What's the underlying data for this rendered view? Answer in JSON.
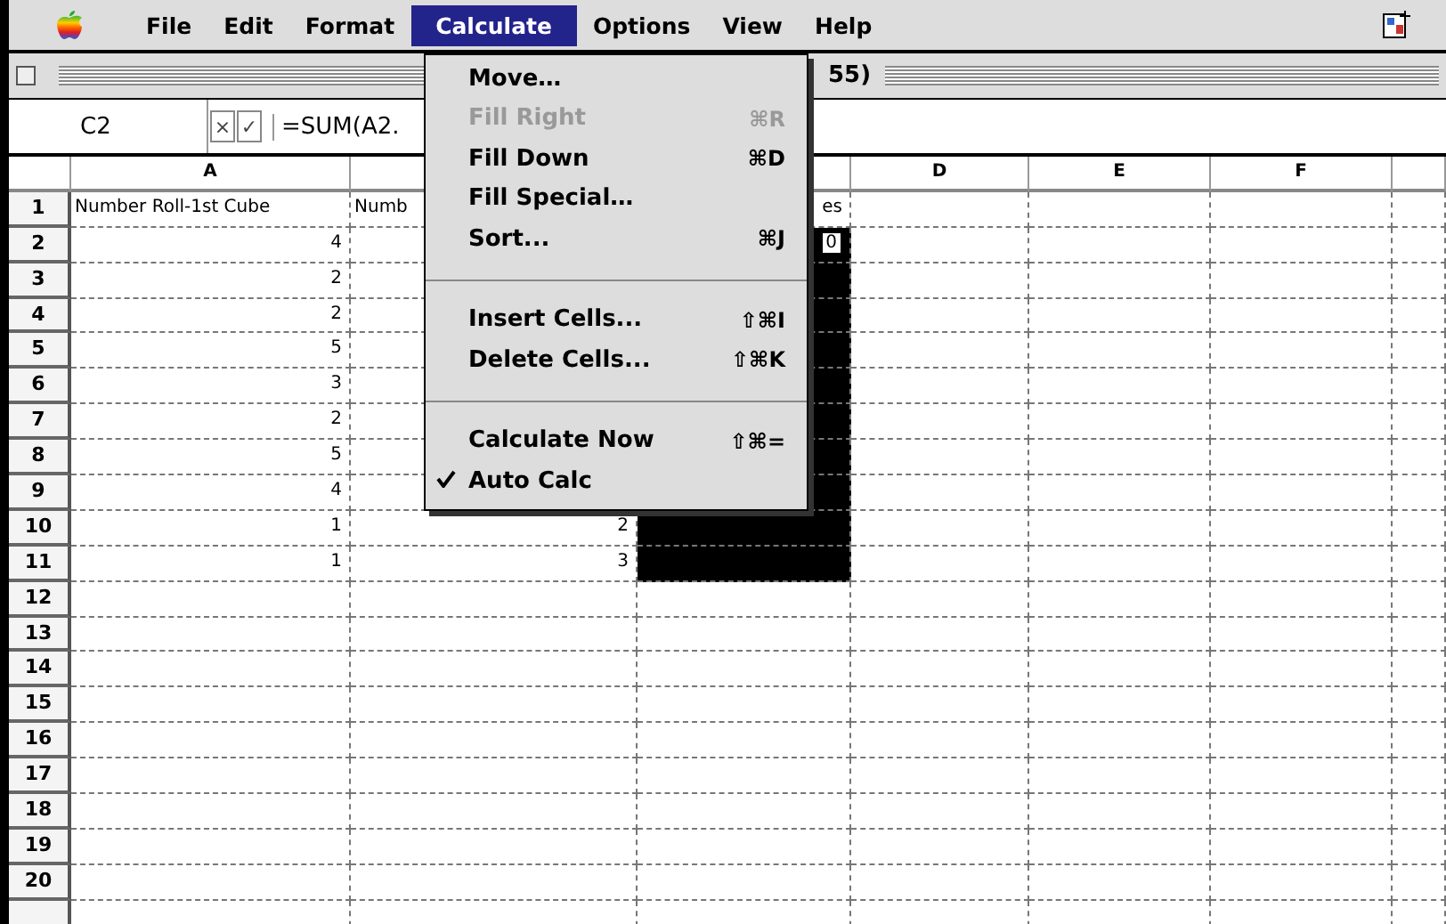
{
  "menubar": {
    "items": [
      {
        "label": "File",
        "selected": false
      },
      {
        "label": "Edit",
        "selected": false
      },
      {
        "label": "Format",
        "selected": false
      },
      {
        "label": "Calculate",
        "selected": true
      },
      {
        "label": "Options",
        "selected": false
      },
      {
        "label": "View",
        "selected": false
      },
      {
        "label": "Help",
        "selected": false
      }
    ]
  },
  "window": {
    "title": "55)"
  },
  "formula_bar": {
    "cell_ref": "C2",
    "cancel": "×",
    "accept": "✓",
    "formula": "=SUM(A2."
  },
  "spreadsheet": {
    "columns": [
      {
        "label": "A"
      },
      {},
      {},
      {
        "label": "D"
      },
      {
        "label": "E"
      },
      {
        "label": "F"
      }
    ],
    "rows": [
      {
        "number": "1",
        "cells": [
          {
            "text": "Number Roll-1st Cube",
            "selected": false
          },
          {
            "text": "Numb",
            "selected": false
          },
          {
            "text": "es",
            "selected": false
          },
          {
            "selected": false
          },
          {
            "selected": false
          },
          {
            "selected": false
          }
        ]
      },
      {
        "number": "2",
        "cells": [
          {
            "text": "4",
            "selected": false
          },
          {
            "selected": false
          },
          {
            "text": "0",
            "selected": true
          },
          {
            "selected": false
          },
          {
            "selected": false
          },
          {
            "selected": false
          }
        ]
      },
      {
        "number": "3",
        "cells": [
          {
            "text": "2",
            "selected": false
          },
          {
            "selected": false
          },
          {
            "selected": true
          },
          {
            "selected": false
          },
          {
            "selected": false
          },
          {
            "selected": false
          }
        ]
      },
      {
        "number": "4",
        "cells": [
          {
            "text": "2",
            "selected": false
          },
          {
            "selected": false
          },
          {
            "selected": true
          },
          {
            "selected": false
          },
          {
            "selected": false
          },
          {
            "selected": false
          }
        ]
      },
      {
        "number": "5",
        "cells": [
          {
            "text": "5",
            "selected": false
          },
          {
            "selected": false
          },
          {
            "selected": true
          },
          {
            "selected": false
          },
          {
            "selected": false
          },
          {
            "selected": false
          }
        ]
      },
      {
        "number": "6",
        "cells": [
          {
            "text": "3",
            "selected": false
          },
          {
            "selected": false
          },
          {
            "selected": true
          },
          {
            "selected": false
          },
          {
            "selected": false
          },
          {
            "selected": false
          }
        ]
      },
      {
        "number": "7",
        "cells": [
          {
            "text": "2",
            "selected": false
          },
          {
            "selected": false
          },
          {
            "selected": true
          },
          {
            "selected": false
          },
          {
            "selected": false
          },
          {
            "selected": false
          }
        ]
      },
      {
        "number": "8",
        "cells": [
          {
            "text": "5",
            "selected": false
          },
          {
            "selected": false
          },
          {
            "selected": true
          },
          {
            "selected": false
          },
          {
            "selected": false
          },
          {
            "selected": false
          }
        ]
      },
      {
        "number": "9",
        "cells": [
          {
            "text": "4",
            "selected": false
          },
          {
            "selected": false
          },
          {
            "selected": true
          },
          {
            "selected": false
          },
          {
            "selected": false
          },
          {
            "selected": false
          }
        ]
      },
      {
        "number": "10",
        "cells": [
          {
            "text": "1",
            "selected": false
          },
          {
            "text": "2",
            "selected": false
          },
          {
            "selected": true
          },
          {
            "selected": false
          },
          {
            "selected": false
          },
          {
            "selected": false
          }
        ]
      },
      {
        "number": "11",
        "cells": [
          {
            "text": "1",
            "selected": false
          },
          {
            "text": "3",
            "selected": false
          },
          {
            "selected": true
          },
          {
            "selected": false
          },
          {
            "selected": false
          },
          {
            "selected": false
          }
        ]
      },
      {
        "number": "12",
        "cells": [
          {
            "selected": false
          },
          {
            "selected": false
          },
          {
            "selected": false
          },
          {
            "selected": false
          },
          {
            "selected": false
          },
          {
            "selected": false
          }
        ]
      },
      {
        "number": "13",
        "cells": [
          {
            "selected": false
          },
          {
            "selected": false
          },
          {
            "selected": false
          },
          {
            "selected": false
          },
          {
            "selected": false
          },
          {
            "selected": false
          }
        ]
      },
      {
        "number": "14",
        "cells": [
          {
            "selected": false
          },
          {
            "selected": false
          },
          {
            "selected": false
          },
          {
            "selected": false
          },
          {
            "selected": false
          },
          {
            "selected": false
          }
        ]
      },
      {
        "number": "15",
        "cells": [
          {
            "selected": false
          },
          {
            "selected": false
          },
          {
            "selected": false
          },
          {
            "selected": false
          },
          {
            "selected": false
          },
          {
            "selected": false
          }
        ]
      },
      {
        "number": "16",
        "cells": [
          {
            "selected": false
          },
          {
            "selected": false
          },
          {
            "selected": false
          },
          {
            "selected": false
          },
          {
            "selected": false
          },
          {
            "selected": false
          }
        ]
      },
      {
        "number": "17",
        "cells": [
          {
            "selected": false
          },
          {
            "selected": false
          },
          {
            "selected": false
          },
          {
            "selected": false
          },
          {
            "selected": false
          },
          {
            "selected": false
          }
        ]
      },
      {
        "number": "18",
        "cells": [
          {
            "selected": false
          },
          {
            "selected": false
          },
          {
            "selected": false
          },
          {
            "selected": false
          },
          {
            "selected": false
          },
          {
            "selected": false
          }
        ]
      },
      {
        "number": "19",
        "cells": [
          {
            "selected": false
          },
          {
            "selected": false
          },
          {
            "selected": false
          },
          {
            "selected": false
          },
          {
            "selected": false
          },
          {
            "selected": false
          }
        ]
      },
      {
        "number": "20",
        "cells": [
          {
            "selected": false
          },
          {
            "selected": false
          },
          {
            "selected": false
          },
          {
            "selected": false
          },
          {
            "selected": false
          },
          {
            "selected": false
          }
        ]
      }
    ]
  },
  "calculate_menu": {
    "items": [
      {
        "kind": "command",
        "label": "Move…",
        "disabled": false,
        "checked": false
      },
      {
        "kind": "command",
        "label": "Fill Right",
        "shortcut": "⌘R",
        "disabled": true,
        "checked": false
      },
      {
        "kind": "command",
        "label": "Fill Down",
        "shortcut": "⌘D",
        "disabled": false,
        "checked": false
      },
      {
        "kind": "command",
        "label": "Fill Special…",
        "disabled": false,
        "checked": false
      },
      {
        "kind": "command",
        "label": "Sort...",
        "shortcut": "⌘J",
        "disabled": false,
        "checked": false
      },
      {
        "kind": "separator"
      },
      {
        "kind": "command",
        "label": "Insert Cells...",
        "shortcut": "⇧⌘I",
        "disabled": false,
        "checked": false
      },
      {
        "kind": "command",
        "label": "Delete Cells...",
        "shortcut": "⇧⌘K",
        "disabled": false,
        "checked": false
      },
      {
        "kind": "separator"
      },
      {
        "kind": "command",
        "label": "Calculate Now",
        "shortcut": "⇧⌘=",
        "disabled": false,
        "checked": false
      },
      {
        "kind": "command",
        "label": "Auto Calc",
        "disabled": false,
        "checked": true
      }
    ]
  }
}
